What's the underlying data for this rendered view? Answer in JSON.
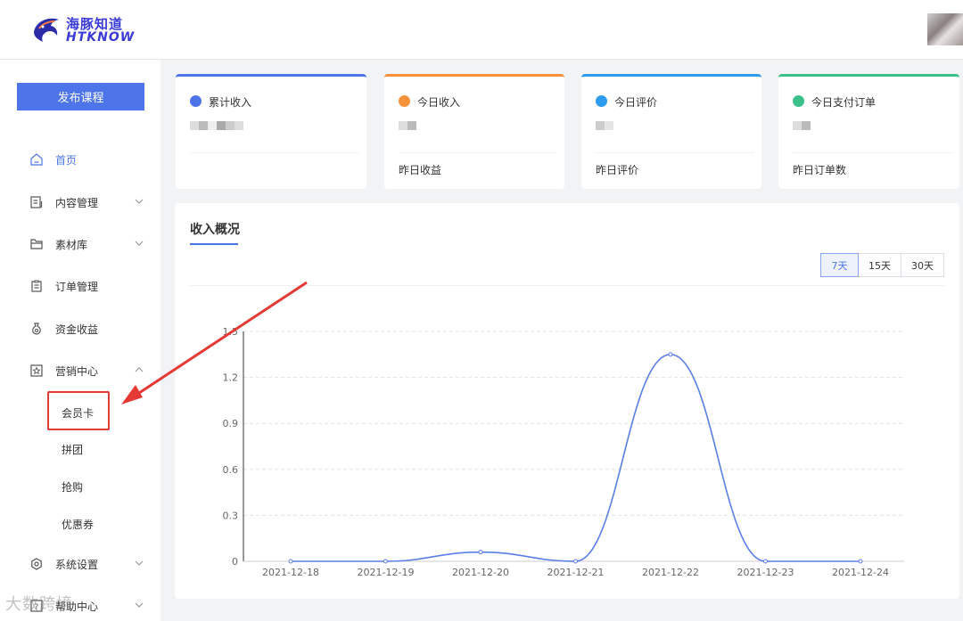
{
  "brand": {
    "name_cn": "海豚知道",
    "name_en": "HTKNOW",
    "color": "#3a3ad6"
  },
  "sidebar": {
    "publish_label": "发布课程",
    "items": [
      {
        "label": "首页",
        "icon": "home-icon",
        "active": true
      },
      {
        "label": "内容管理",
        "icon": "content-icon",
        "expandable": true
      },
      {
        "label": "素材库",
        "icon": "folder-icon",
        "expandable": true
      },
      {
        "label": "订单管理",
        "icon": "order-icon"
      },
      {
        "label": "资金收益",
        "icon": "money-bag-icon"
      },
      {
        "label": "营销中心",
        "icon": "star-icon",
        "expandable": true,
        "expanded": true
      },
      {
        "label": "系统设置",
        "icon": "gear-icon",
        "expandable": true
      },
      {
        "label": "帮助中心",
        "icon": "help-icon",
        "expandable": true
      }
    ],
    "marketing_children": [
      "会员卡",
      "拼团",
      "抢购",
      "优惠券"
    ]
  },
  "stats": [
    {
      "title": "累计收入",
      "footer": "",
      "color": "#4d74e9",
      "icon": "chart-icon"
    },
    {
      "title": "今日收入",
      "footer": "昨日收益",
      "color": "#f7923a",
      "icon": "chart-icon"
    },
    {
      "title": "今日评价",
      "footer": "昨日评价",
      "color": "#2d9bf0",
      "icon": "heart-icon"
    },
    {
      "title": "今日支付订单",
      "footer": "昨日订单数",
      "color": "#3cc08a",
      "icon": "receipt-icon"
    }
  ],
  "income": {
    "title": "收入概况",
    "ranges": [
      "7天",
      "15天",
      "30天"
    ],
    "selected_range": "7天"
  },
  "chart_data": {
    "type": "line",
    "categories": [
      "2021-12-18",
      "2021-12-19",
      "2021-12-20",
      "2021-12-21",
      "2021-12-22",
      "2021-12-23",
      "2021-12-24"
    ],
    "values": [
      0,
      0,
      0.06,
      0,
      1.35,
      0,
      0
    ],
    "yticks": [
      "0",
      "0.3",
      "0.6",
      "0.9",
      "1.2",
      "1.5"
    ],
    "ylim": [
      0,
      1.5
    ],
    "color": "#5b7fe6",
    "grid": true
  },
  "watermark": "大数跨境"
}
